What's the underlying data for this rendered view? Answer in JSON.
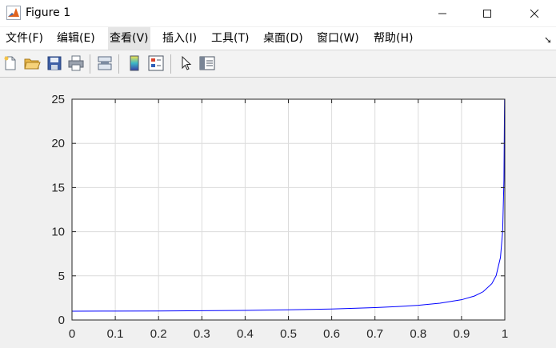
{
  "window": {
    "title": "Figure 1",
    "minimize_glyph": "—",
    "maximize_glyph": "☐",
    "close_glyph": "✕"
  },
  "menu": {
    "items": [
      {
        "label": "文件(F)"
      },
      {
        "label": "编辑(E)"
      },
      {
        "label": "查看(V)"
      },
      {
        "label": "插入(I)"
      },
      {
        "label": "工具(T)"
      },
      {
        "label": "桌面(D)"
      },
      {
        "label": "窗口(W)"
      },
      {
        "label": "帮助(H)"
      }
    ],
    "active_index": 2,
    "pin_glyph": "➘"
  },
  "toolbar": {
    "buttons": [
      "new-figure-icon",
      "open-folder-icon",
      "save-icon",
      "print-icon",
      "link-plot-icon",
      "insert-colorbar-icon",
      "insert-legend-icon",
      "edit-plot-arrow-icon",
      "property-inspector-icon"
    ]
  },
  "chart_data": {
    "type": "line",
    "title": "",
    "xlabel": "",
    "ylabel": "",
    "xlim": [
      0,
      1
    ],
    "ylim": [
      0,
      25
    ],
    "x_ticks": [
      0,
      0.1,
      0.2,
      0.3,
      0.4,
      0.5,
      0.6,
      0.7,
      0.8,
      0.9,
      1
    ],
    "x_tick_labels": [
      "0",
      "0.1",
      "0.2",
      "0.3",
      "0.4",
      "0.5",
      "0.6",
      "0.7",
      "0.8",
      "0.9",
      "1"
    ],
    "y_ticks": [
      0,
      5,
      10,
      15,
      20,
      25
    ],
    "y_tick_labels": [
      "0",
      "5",
      "10",
      "15",
      "20",
      "25"
    ],
    "grid": true,
    "series": [
      {
        "color": "#0000ff",
        "x": [
          0,
          0.1,
          0.2,
          0.3,
          0.4,
          0.5,
          0.6,
          0.7,
          0.75,
          0.8,
          0.85,
          0.9,
          0.93,
          0.95,
          0.97,
          0.98,
          0.99,
          0.995,
          0.998,
          0.999,
          0.9995,
          0.9999,
          1
        ],
        "y": [
          1.0,
          1.005,
          1.021,
          1.048,
          1.091,
          1.155,
          1.25,
          1.4,
          1.512,
          1.667,
          1.898,
          2.294,
          2.72,
          3.203,
          4.113,
          5.025,
          7.089,
          10.01,
          15.82,
          22.37,
          25,
          25,
          25
        ]
      }
    ]
  }
}
